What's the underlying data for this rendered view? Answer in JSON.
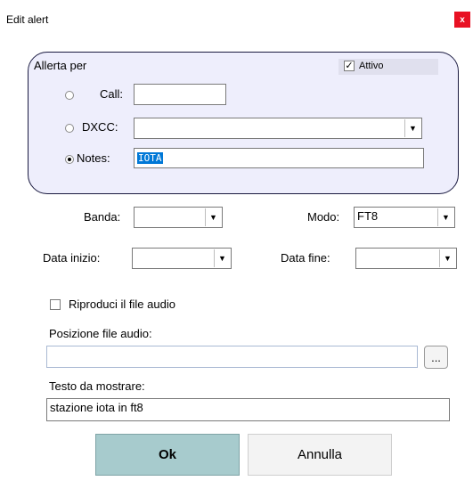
{
  "window": {
    "title": "Edit alert",
    "close_label": "x"
  },
  "group": {
    "title": "Allerta per",
    "active_label": "Attivo",
    "active_checked": true,
    "call_label": "Call:",
    "call_value": "",
    "dxcc_label": "DXCC:",
    "dxcc_value": "",
    "notes_label": "Notes:",
    "notes_value": "IOTA",
    "selected_option": "notes"
  },
  "banda": {
    "label": "Banda:",
    "value": ""
  },
  "modo": {
    "label": "Modo:",
    "value": "FT8"
  },
  "data_inizio": {
    "label": "Data inizio:",
    "value": ""
  },
  "data_fine": {
    "label": "Data fine:",
    "value": ""
  },
  "audio": {
    "play_label": "Riproduci il file audio",
    "play_checked": false,
    "path_label": "Posizione file audio:",
    "path_value": "",
    "browse_label": "..."
  },
  "message": {
    "label": "Testo da mostrare:",
    "value": "stazione iota in ft8"
  },
  "buttons": {
    "ok": "Ok",
    "cancel": "Annulla"
  },
  "icons": {
    "checkmark": "check-icon",
    "arrow": "chevron-down-icon"
  }
}
